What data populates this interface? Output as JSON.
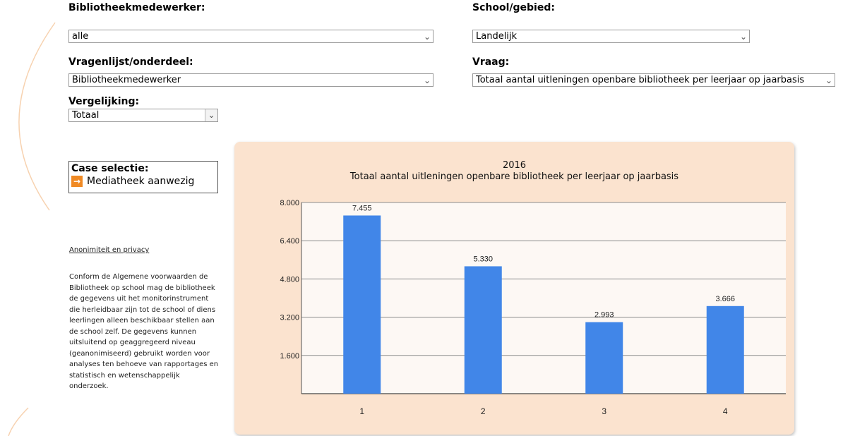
{
  "filters": {
    "medewerker": {
      "label": "Bibliotheekmedewerker:",
      "value": "alle"
    },
    "school": {
      "label": "School/gebied:",
      "value": "Landelijk"
    },
    "vragenlijst": {
      "label": "Vragenlijst/onderdeel:",
      "value": "Bibliotheekmedewerker"
    },
    "vraag": {
      "label": "Vraag:",
      "value": "Totaal aantal uitleningen openbare bibliotheek per leerjaar op jaarbasis"
    },
    "vergelijking": {
      "label": "Vergelijking:",
      "value": "Totaal"
    }
  },
  "case_selectie": {
    "title": "Case selectie:",
    "item": "Mediatheek aanwezig"
  },
  "privacy": {
    "title": "Anonimiteit en privacy",
    "text": "Conform de Algemene voorwaarden de Bibliotheek op school mag de bibliotheek de gegevens uit het monitorinstrument die herleidbaar zijn tot de school of diens leerlingen alleen beschikbaar stellen aan de school zelf. De gegevens kunnen uitsluitend op geaggregeerd niveau (geanonimiseerd) gebruikt worden voor analyses ten behoeve van rapportages en statistisch en wetenschappelijk onderzoek."
  },
  "colors": {
    "bar": "#4186e8",
    "panel": "#fbe3cf",
    "plot_bg": "#fdf8f4",
    "accent": "#f08a24"
  },
  "chart_data": {
    "type": "bar",
    "title": "2016",
    "subtitle": "Totaal aantal uitleningen openbare bibliotheek per leerjaar op jaarbasis",
    "categories": [
      "1",
      "2",
      "3",
      "4"
    ],
    "values": [
      7455,
      5330,
      2993,
      3666
    ],
    "value_labels": [
      "7.455",
      "5.330",
      "2.993",
      "3.666"
    ],
    "ylim": [
      0,
      8000
    ],
    "yticks": [
      1600,
      3200,
      4800,
      6400,
      8000
    ],
    "ytick_labels": [
      "1.600",
      "3.200",
      "4.800",
      "6.400",
      "8.000"
    ],
    "grid": true,
    "legend": "none"
  }
}
